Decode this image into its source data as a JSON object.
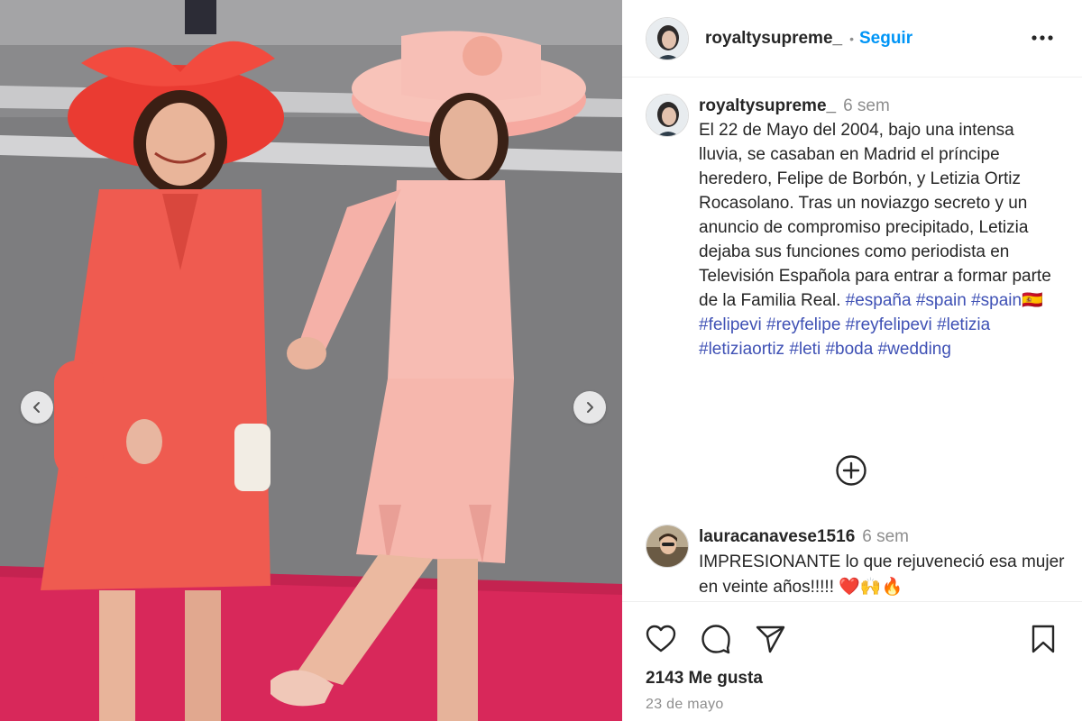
{
  "post": {
    "username": "royaltysupreme_",
    "separator": "•",
    "follow_label": "Seguir",
    "more_icon": "more-horizontal-icon"
  },
  "caption": {
    "username": "royaltysupreme_",
    "time_ago": "6 sem",
    "text": "El 22 de Mayo del 2004, bajo una intensa\nlluvia, se casaban en Madrid el príncipe heredero, Felipe de Borbón, y Letizia Ortiz Rocasolano. Tras un noviazgo secreto y un anuncio de compromiso precipitado, Letizia dejaba sus funciones como periodista en Televisión Española para entrar a formar parte de la Familia Real.",
    "hashtags": [
      "#españa",
      "#spain",
      "#spain🇪🇸",
      "#felipevi",
      "#reyfelipe",
      "#reyfelipevi",
      "#letizia",
      "#letiziaortiz",
      "#leti",
      "#boda",
      "#wedding"
    ]
  },
  "comment": {
    "username": "lauracanavese1516",
    "time_ago": "6 sem",
    "text": "IMPRESIONANTE lo que rejuveneció esa mujer en veinte años!!!!! ❤️🙌🔥"
  },
  "actions": {
    "icons": [
      "heart-icon",
      "comment-icon",
      "share-icon",
      "bookmark-icon"
    ],
    "likes": "2143 Me gusta",
    "date": "23 de mayo"
  },
  "colors": {
    "follow": "#0095f6",
    "hashtag": "#3f51b5",
    "muted": "#8e8e8e",
    "red_outfit": "#e85a5a",
    "pink_outfit": "#f5b5ae",
    "carpet": "#d8285a"
  }
}
